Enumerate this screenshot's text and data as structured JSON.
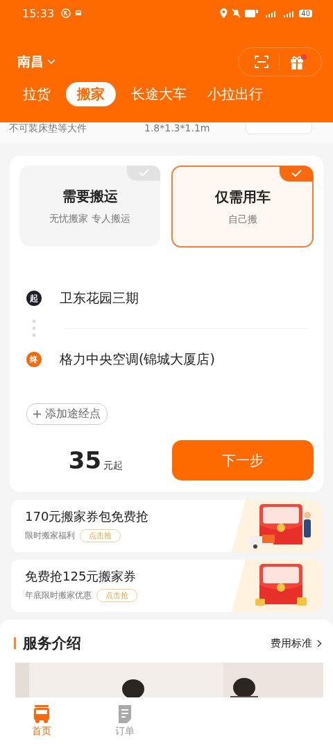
{
  "status_bar": {
    "time": "15:33",
    "battery": "40"
  },
  "city": "南昌",
  "gift_has_dot": true,
  "tabs": [
    {
      "label": "拉货",
      "selected": false
    },
    {
      "label": "搬家",
      "selected": true
    },
    {
      "label": "长途大车",
      "selected": false
    },
    {
      "label": "小拉出行",
      "selected": false
    }
  ],
  "peek_row": {
    "note": "不可装床垫等大件",
    "size": "1.8*1.3*1.1m"
  },
  "options": [
    {
      "title": "需要搬运",
      "subtitle": "无忧搬家 专人搬运",
      "selected": false
    },
    {
      "title": "仅需用车",
      "subtitle": "自己搬",
      "selected": true
    }
  ],
  "route": [
    {
      "kind": "start",
      "marker": "起",
      "place": "卫东花园三期"
    },
    {
      "kind": "end",
      "marker": "终",
      "place": "格力中央空调(锦城大厦店)"
    }
  ],
  "add_stop": "添加途经点",
  "price": {
    "amount": "35",
    "unit": "元起"
  },
  "next_button": "下一步",
  "promos": [
    {
      "title": "170元搬家券包免费抢",
      "subtitle": "限时搬家福利",
      "action": "点击抢"
    },
    {
      "title": "免费抢125元搬家券",
      "subtitle": "年底限时搬家优惠",
      "action": "点击抢"
    }
  ],
  "service": {
    "title": "服务介绍",
    "link": "费用标准"
  },
  "nav": [
    {
      "kind": "home",
      "label": "首页",
      "selected": true
    },
    {
      "kind": "orders",
      "label": "订单",
      "selected": false
    }
  ]
}
